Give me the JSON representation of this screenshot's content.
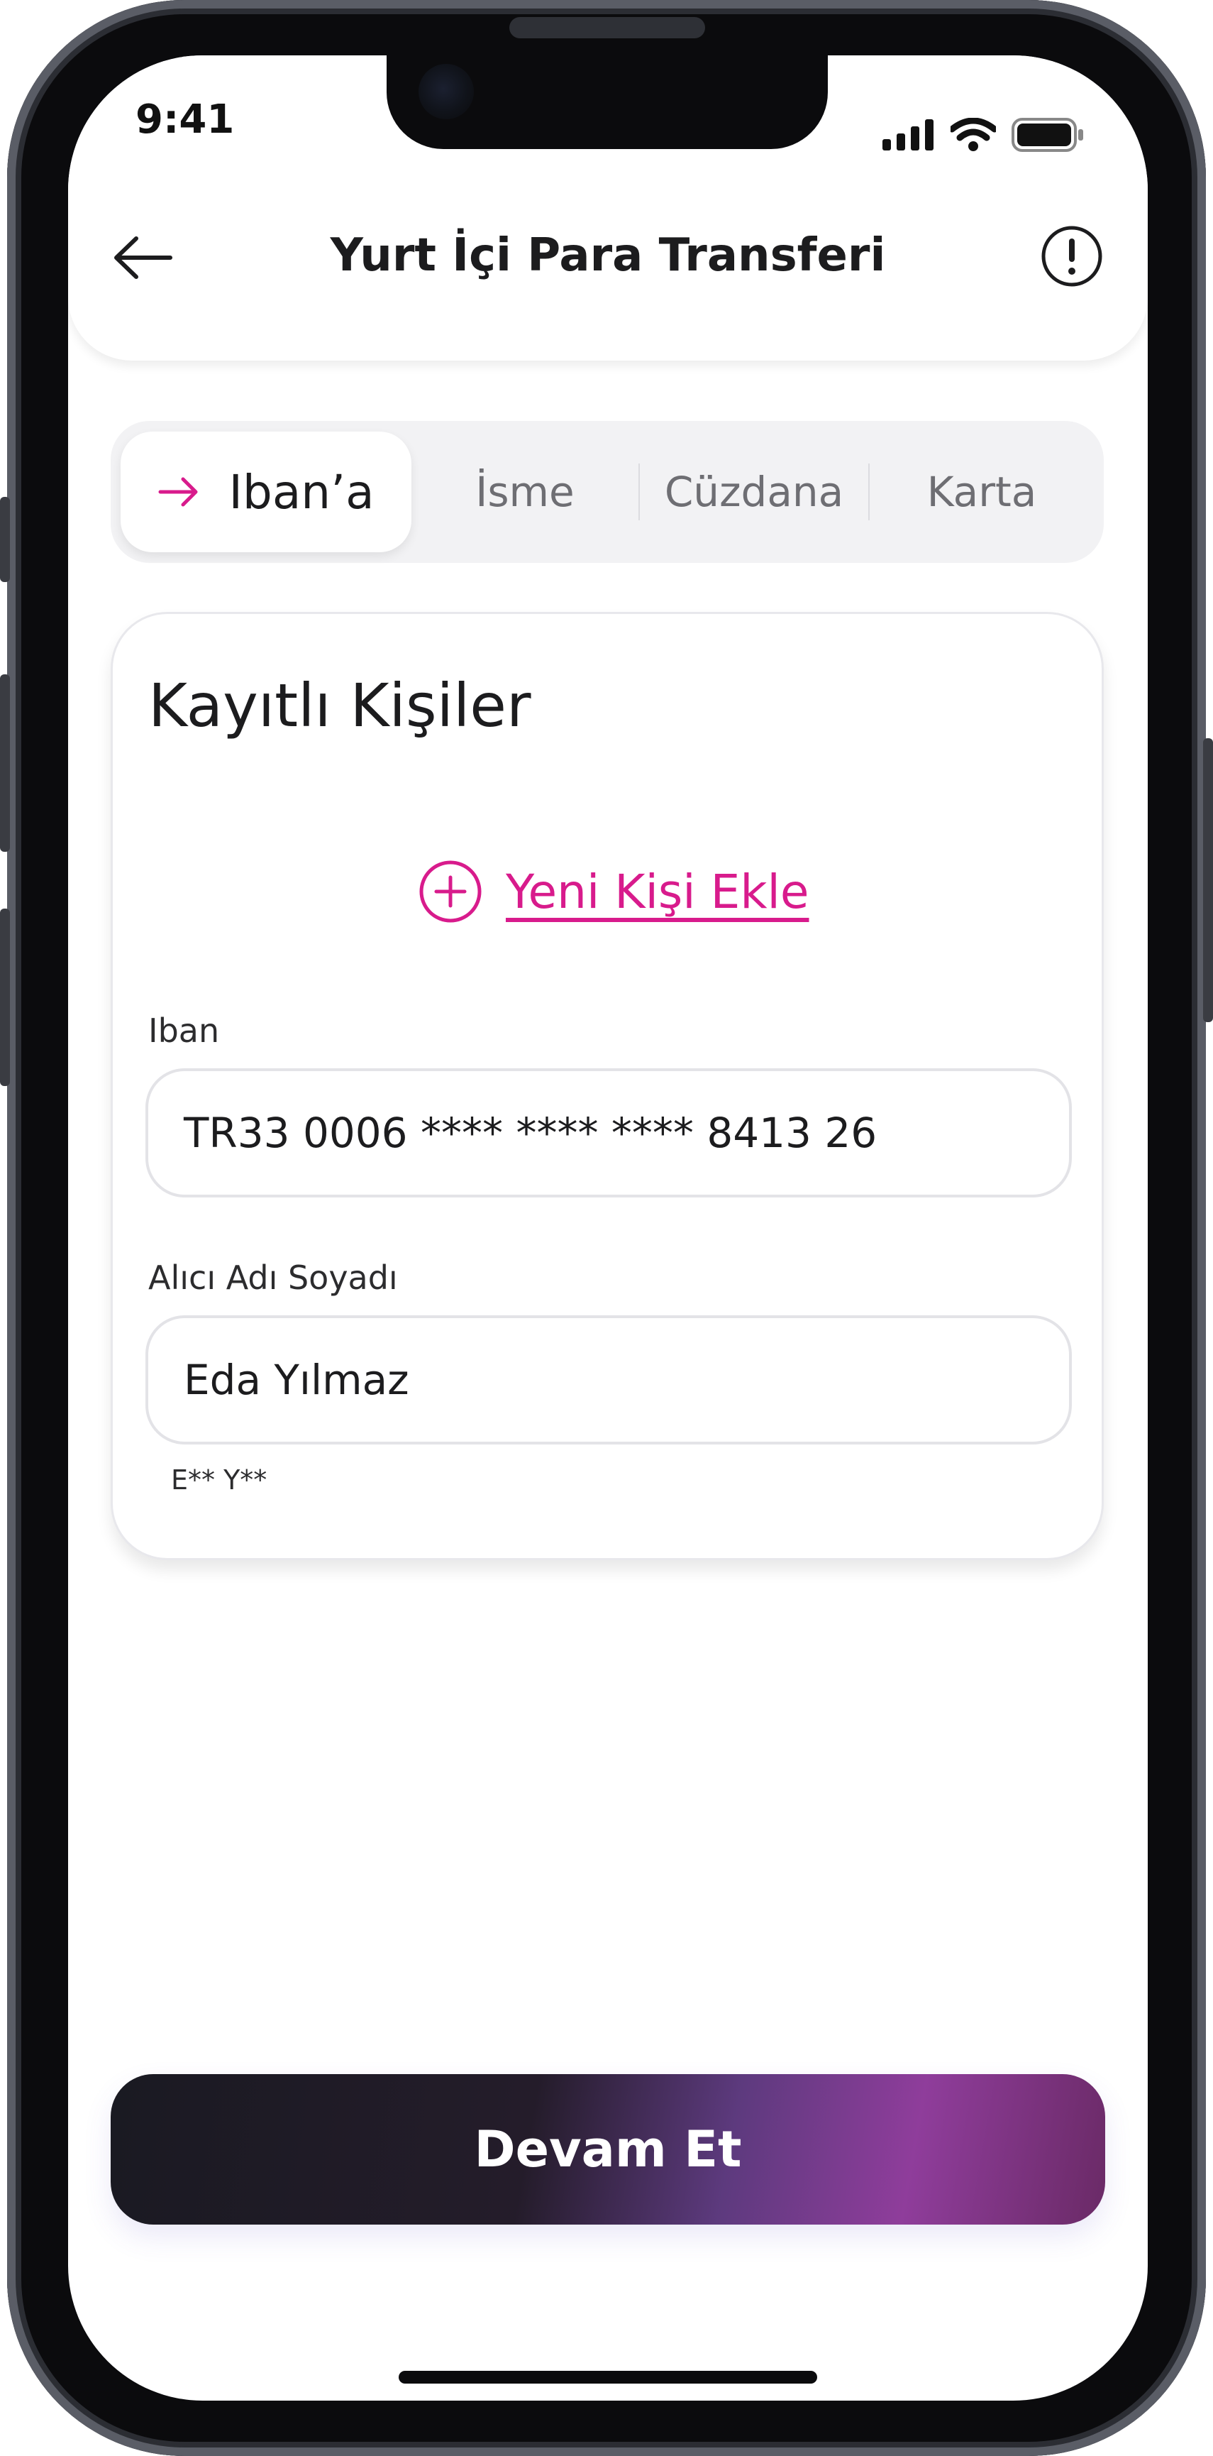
{
  "status_bar": {
    "time": "9:41"
  },
  "header": {
    "title": "Yurt İçi Para Transferi"
  },
  "tabs": [
    {
      "label": "Iban’a",
      "active": true
    },
    {
      "label": "İsme",
      "active": false
    },
    {
      "label": "Cüzdana",
      "active": false
    },
    {
      "label": "Karta",
      "active": false
    }
  ],
  "card": {
    "title": "Kayıtlı Kişiler",
    "add_contact_label": "Yeni Kişi Ekle",
    "iban": {
      "label": "Iban",
      "value": "TR33 0006 **** **** **** 8413 26"
    },
    "recipient": {
      "label": "Alıcı Adı Soyadı",
      "value": "Eda Yılmaz",
      "masked": "E** Y**"
    }
  },
  "cta": {
    "label": "Devam Et"
  },
  "colors": {
    "accent": "#d81b8c",
    "text": "#1c1c1e"
  },
  "icons": [
    "back-arrow-icon",
    "info-icon",
    "arrow-right-icon",
    "plus-circle-icon",
    "signal-icon",
    "wifi-icon",
    "battery-icon"
  ]
}
